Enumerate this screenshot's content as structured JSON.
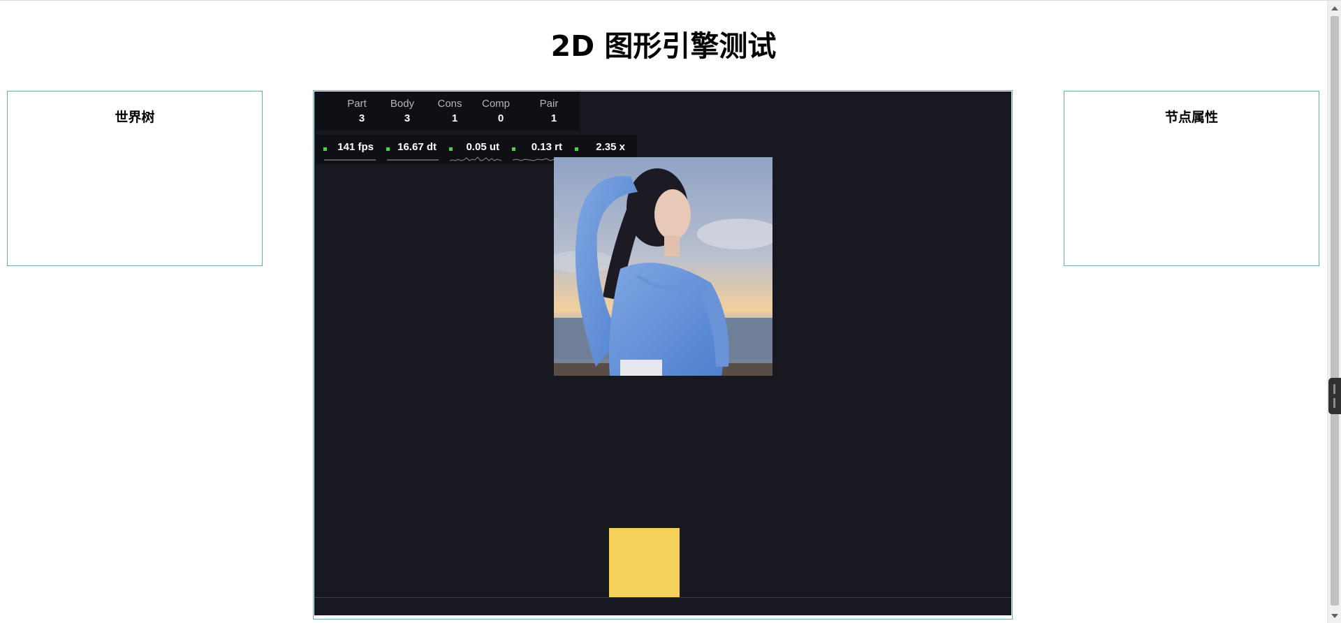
{
  "page": {
    "title": "2D 图形引擎测试"
  },
  "left_panel": {
    "title": "世界树"
  },
  "right_panel": {
    "title": "节点属性"
  },
  "stats": [
    {
      "label": "Part",
      "value": "3"
    },
    {
      "label": "Body",
      "value": "3"
    },
    {
      "label": "Cons",
      "value": "1"
    },
    {
      "label": "Comp",
      "value": "0"
    },
    {
      "label": "Pair",
      "value": "1"
    }
  ],
  "performance": [
    {
      "value": "141 fps"
    },
    {
      "value": "16.67 dt"
    },
    {
      "value": "0.05 ut"
    },
    {
      "value": "0.13 rt"
    },
    {
      "value": "2.35 x"
    }
  ],
  "colors": {
    "canvas_background": "#171820",
    "panel_border": "#6aa7b8",
    "box_fill": "#f5d15a",
    "indicator": "#3ddc3d"
  },
  "scene": {
    "image": "photo of a woman in a blue top against a sky",
    "box": "yellow square body"
  }
}
